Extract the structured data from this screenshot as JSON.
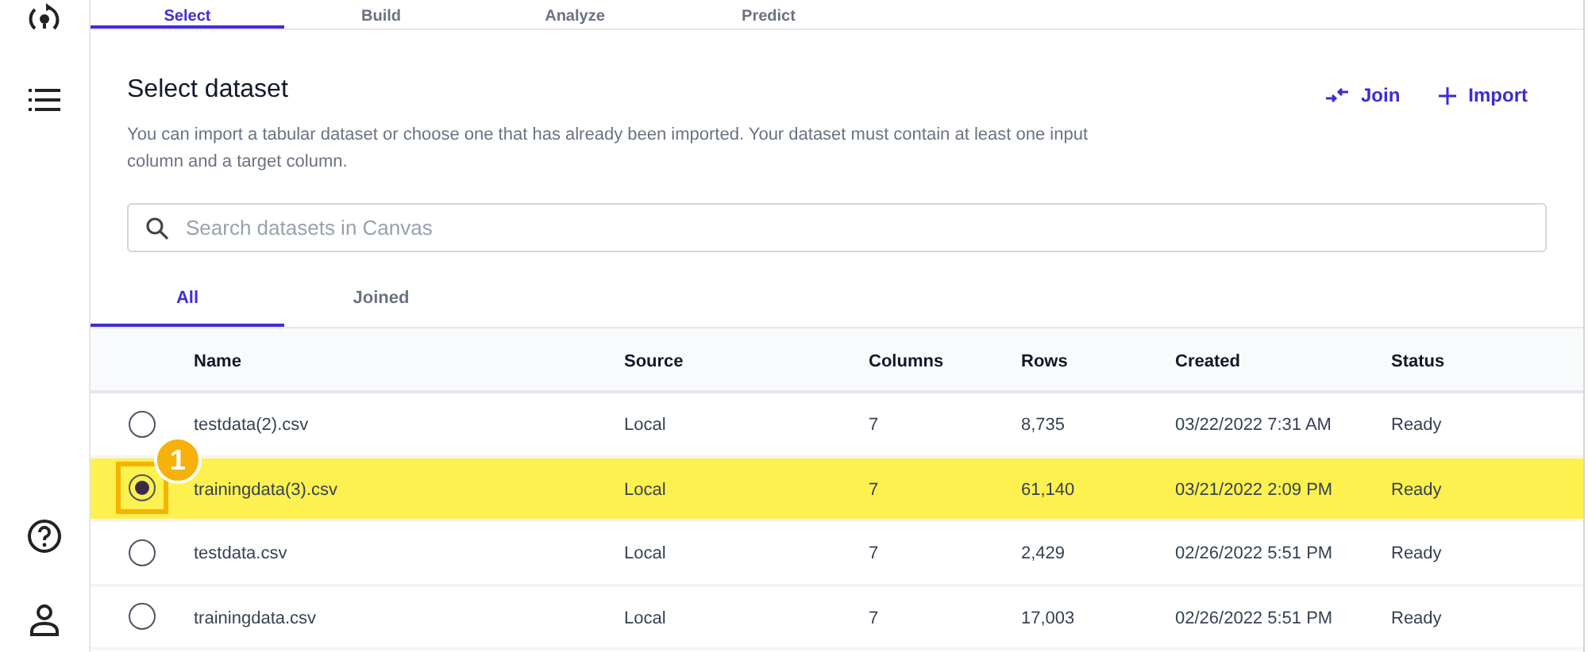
{
  "top_tabs": [
    {
      "label": "Select",
      "selected": true
    },
    {
      "label": "Build",
      "selected": false
    },
    {
      "label": "Analyze",
      "selected": false
    },
    {
      "label": "Predict",
      "selected": false
    }
  ],
  "panel": {
    "title": "Select dataset",
    "description": "You can import a tabular dataset or choose one that has already been imported. Your dataset must contain at least one input column and a target column.",
    "actions": [
      {
        "kind": "join",
        "label": "Join"
      },
      {
        "kind": "import",
        "label": "Import"
      }
    ]
  },
  "search": {
    "placeholder": "Search datasets in Canvas"
  },
  "dataset_tabs": [
    {
      "label": "All",
      "selected": true
    },
    {
      "label": "Joined",
      "selected": false
    }
  ],
  "table": {
    "columns": [
      "Name",
      "Source",
      "Columns",
      "Rows",
      "Created",
      "Status"
    ],
    "rows": [
      {
        "selected": false,
        "highlighted": false,
        "cells": [
          "testdata(2).csv",
          "Local",
          "7",
          "8,735",
          "03/22/2022 7:31 AM",
          "Ready"
        ]
      },
      {
        "selected": true,
        "highlighted": true,
        "callout": "1",
        "cells": [
          "trainingdata(3).csv",
          "Local",
          "7",
          "61,140",
          "03/21/2022 2:09 PM",
          "Ready"
        ]
      },
      {
        "selected": false,
        "highlighted": false,
        "cells": [
          "testdata.csv",
          "Local",
          "7",
          "2,429",
          "02/26/2022 5:51 PM",
          "Ready"
        ]
      },
      {
        "selected": false,
        "highlighted": false,
        "cells": [
          "trainingdata.csv",
          "Local",
          "7",
          "17,003",
          "02/26/2022 5:51 PM",
          "Ready"
        ]
      }
    ]
  }
}
